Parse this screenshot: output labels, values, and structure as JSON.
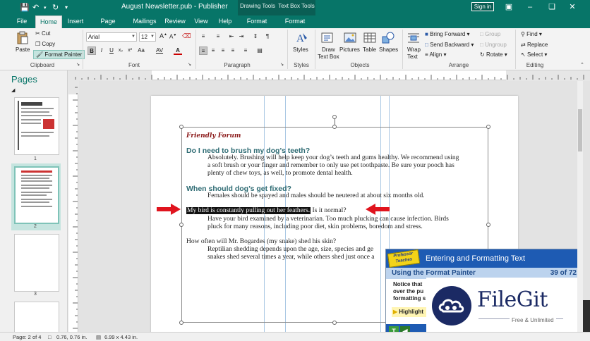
{
  "titlebar": {
    "file_name": "August Newsletter.pub - Publisher",
    "context_drawing": "Drawing Tools",
    "context_textbox": "Text Box Tools",
    "signin": "Sign in"
  },
  "tabs": [
    "File",
    "Home",
    "Insert",
    "Page Design",
    "Mailings",
    "Review",
    "View",
    "Help",
    "Format",
    "Format"
  ],
  "active_tab": "Home",
  "ribbon": {
    "clipboard": {
      "paste": "Paste",
      "cut": "Cut",
      "copy": "Copy",
      "format_painter": "Format Painter",
      "label": "Clipboard"
    },
    "font": {
      "name": "Arial",
      "size": "12",
      "label": "Font"
    },
    "paragraph": {
      "label": "Paragraph"
    },
    "styles": {
      "styles": "Styles",
      "label": "Styles"
    },
    "objects": {
      "draw_text_box_1": "Draw",
      "draw_text_box_2": "Text Box",
      "pictures": "Pictures",
      "table": "Table",
      "shapes": "Shapes",
      "label": "Objects"
    },
    "arrange": {
      "wrap_text_1": "Wrap",
      "wrap_text_2": "Text",
      "bring_forward": "Bring Forward",
      "send_backward": "Send Backward",
      "align": "Align",
      "group": "Group",
      "ungroup": "Ungroup",
      "rotate": "Rotate",
      "label": "Arrange"
    },
    "editing": {
      "find": "Find",
      "replace": "Replace",
      "select": "Select",
      "label": "Editing"
    }
  },
  "pages_pane": {
    "title": "Pages",
    "pages": [
      "1",
      "2",
      "3"
    ],
    "selected": "2"
  },
  "document": {
    "forum_title": "Friendly Forum",
    "q1": "Do I need to brush my dog’s teeth?",
    "a1_l1": "Absolutely. Brushing will help keep your dog’s teeth and gums healthy. We recommend using",
    "a1_l2": "a soft brush or your finger and remember to only use pet toothpaste. Be sure your pooch has",
    "a1_l3": "plenty of chew toys, as well, to promote dental health.",
    "q2": "When should dog’s get fixed?",
    "a2": "Females should be spayed and males should be neutered at about six months old.",
    "q3_selected": "My bird is constantly pulling out her feathers.",
    "q3_rest": " Is it normal?",
    "a3_l1": "Have your bird examined by a veterinarian. Too much plucking can cause infection. Birds",
    "a3_l2": "pluck for many reasons, including poor diet, skin problems, boredom and stress.",
    "q4": "How often will Mr. Bogardes (my snake) shed his skin?",
    "a4_l1": "Reptilian shedding depends upon the age, size, species and ge",
    "a4_l2": "snakes shed several times a year, while others shed just once a"
  },
  "overlay": {
    "logo": "Professor Teaches",
    "title": "Entering and Formatting Text",
    "lesson": "Using the Format Painter",
    "progress": "39 of 72",
    "body": "Notice that over the pu formatting s",
    "highlight": "Highlight"
  },
  "watermark": {
    "name": "FileGit",
    "tagline": "Free & Unlimited"
  },
  "status": {
    "page": "Page: 2 of 4",
    "position": "0.76, 0.76 in.",
    "size": "6.99 x 4.43 in."
  }
}
